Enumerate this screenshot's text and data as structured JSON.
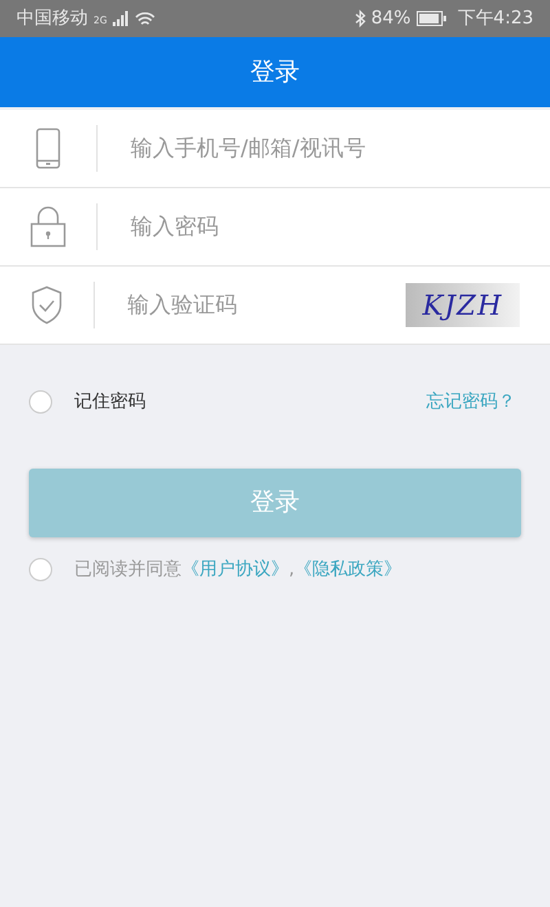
{
  "status_bar": {
    "carrier": "中国移动",
    "network": "2G",
    "battery_text": "84%",
    "time": "下午4:23"
  },
  "header": {
    "title": "登录"
  },
  "fields": [
    {
      "kind": "phone",
      "placeholder": "输入手机号/邮箱/视讯号"
    },
    {
      "kind": "password",
      "placeholder": "输入密码"
    },
    {
      "kind": "captcha",
      "placeholder": "输入验证码",
      "captcha_text": "KJZH"
    }
  ],
  "remember": {
    "label": "记住密码",
    "checked": false
  },
  "forgot_link": "忘记密码？",
  "login_button": {
    "label": "登录",
    "disabled": true
  },
  "agreement": {
    "checked": false,
    "text": "已阅读并同意",
    "links": [
      "《用户协议》",
      "《隐私政策》"
    ],
    "separator": ","
  }
}
